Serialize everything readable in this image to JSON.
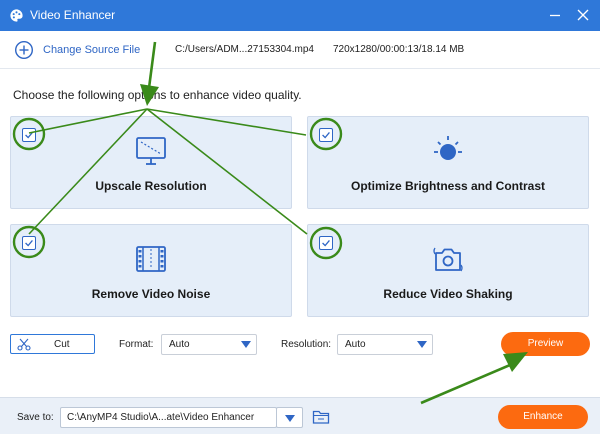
{
  "window": {
    "title": "Video Enhancer",
    "icons": {
      "app": "palette-icon",
      "minimize": "minimize-icon",
      "close": "close-icon"
    }
  },
  "toolbar": {
    "change_source_label": "Change Source File",
    "file_path": "C:/Users/ADM...27153304.mp4",
    "file_info": "720x1280/00:00:13/18.14 MB"
  },
  "instruction": "Choose the following options to enhance video quality.",
  "options": [
    {
      "label": "Upscale Resolution",
      "checked": true,
      "icon": "monitor-upscale-icon"
    },
    {
      "label": "Optimize Brightness and Contrast",
      "checked": true,
      "icon": "brightness-icon"
    },
    {
      "label": "Remove Video Noise",
      "checked": true,
      "icon": "film-noise-icon"
    },
    {
      "label": "Reduce Video Shaking",
      "checked": true,
      "icon": "camera-stabilize-icon"
    }
  ],
  "settings": {
    "cut_label": "Cut",
    "format_label": "Format:",
    "format_value": "Auto",
    "resolution_label": "Resolution:",
    "resolution_value": "Auto",
    "preview_label": "Preview"
  },
  "bottom": {
    "save_to_label": "Save to:",
    "save_path": "C:\\AnyMP4 Studio\\A...ate\\Video Enhancer",
    "enhance_label": "Enhance"
  },
  "colors": {
    "titlebar": "#2f78d9",
    "accent_blue": "#2f66c5",
    "card_bg": "#e5eef9",
    "button_orange": "#fc6a10",
    "annotation_green": "#3a8a1a"
  }
}
